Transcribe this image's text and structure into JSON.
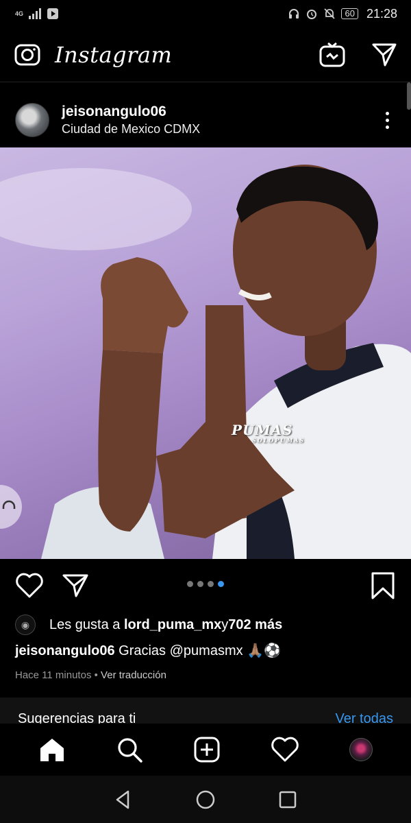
{
  "status_bar": {
    "network": "4G",
    "battery": "60",
    "time": "21:28"
  },
  "header": {
    "app_title": "Instagram",
    "icons": [
      "camera-icon",
      "igtv-icon",
      "direct-message-icon"
    ]
  },
  "post": {
    "username": "jeisonangulo06",
    "location": "Ciudad de Mexico CDMX",
    "image_watermark": {
      "main": "PUMAS",
      "sub": "SOLOPUMAS"
    },
    "carousel": {
      "count": 4,
      "active_index": 3
    },
    "likes": {
      "prefix": "Les gusta a ",
      "liked_by": "lord_puma_mx",
      "conjunction": " y ",
      "others": "702 más"
    },
    "caption": {
      "username": "jeisonangulo06",
      "text": " Gracias @pumasmx 🙏🏽⚽"
    },
    "timestamp": "Hace 11 minutos",
    "separator": " • ",
    "translate_label": "Ver traducción"
  },
  "suggestions": {
    "title": "Sugerencias para ti",
    "see_all": "Ver todas"
  },
  "bottom_nav": {
    "items": [
      "home-icon",
      "search-icon",
      "new-post-icon",
      "activity-icon",
      "profile-avatar"
    ]
  },
  "colors": {
    "accent": "#3897f0",
    "background": "#000000"
  }
}
